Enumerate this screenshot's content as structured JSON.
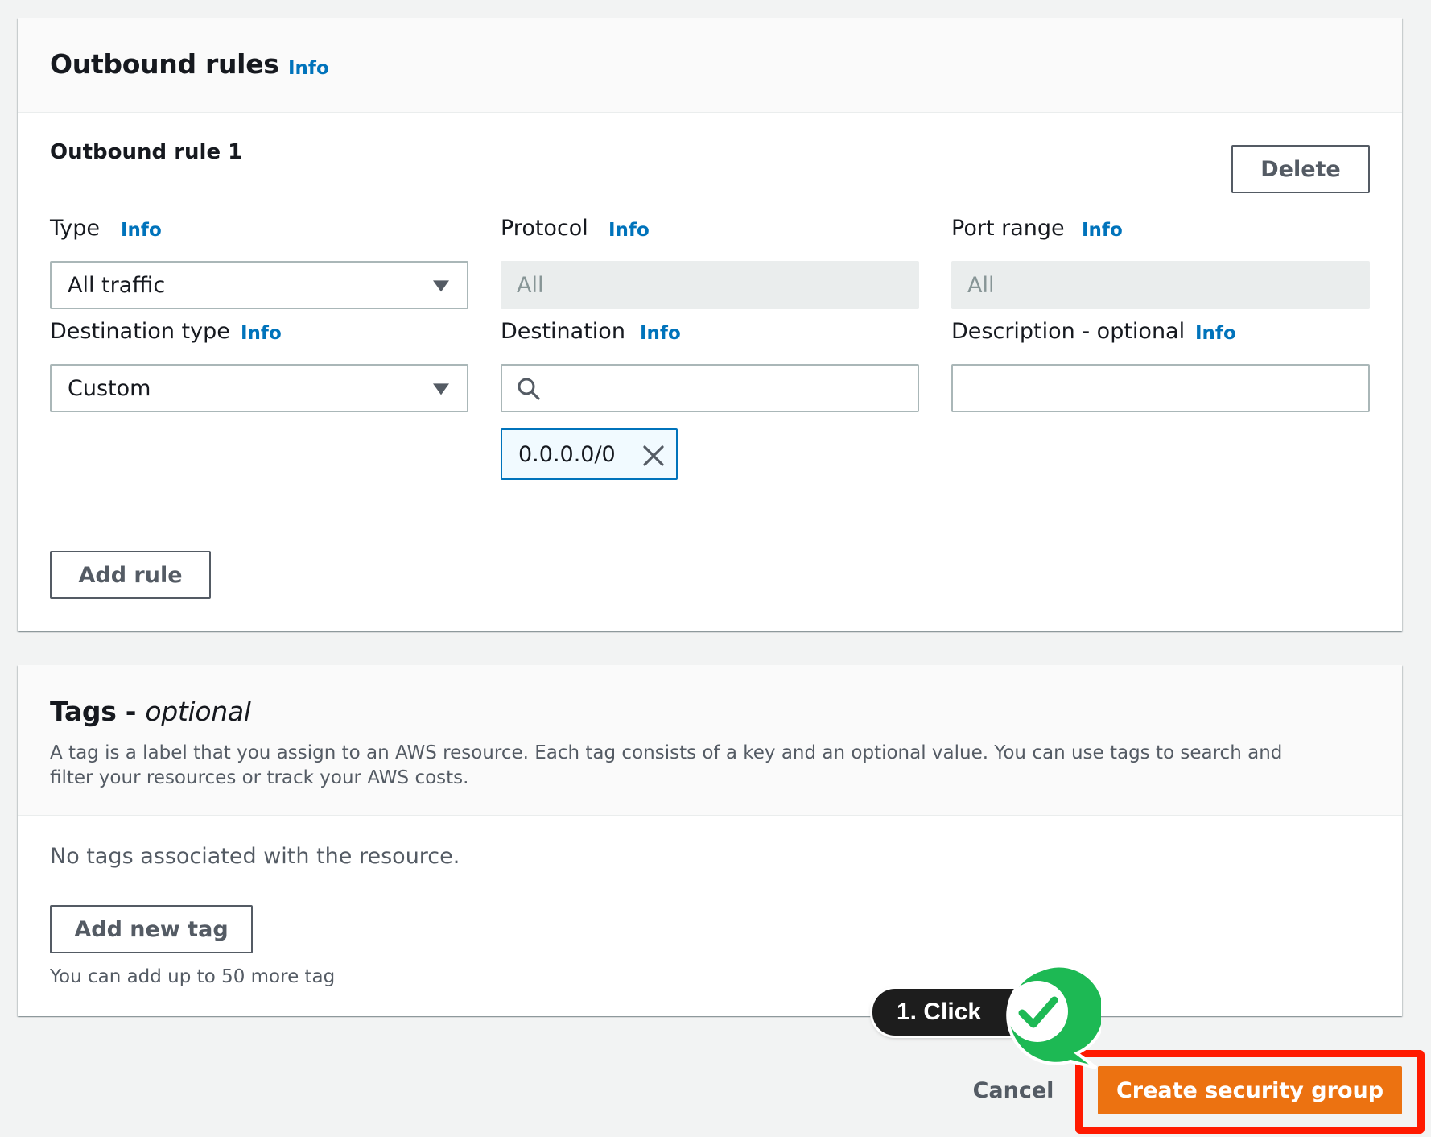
{
  "outbound": {
    "title": "Outbound rules",
    "info": "Info",
    "rule_title": "Outbound rule 1",
    "delete_label": "Delete",
    "fields": {
      "type": {
        "label": "Type",
        "info": "Info",
        "value": "All traffic"
      },
      "protocol": {
        "label": "Protocol",
        "info": "Info",
        "value": "All"
      },
      "port_range": {
        "label": "Port range",
        "info": "Info",
        "value": "All"
      },
      "destination_type": {
        "label": "Destination type",
        "info": "Info",
        "value": "Custom"
      },
      "destination": {
        "label": "Destination",
        "info": "Info",
        "value": "",
        "token": "0.0.0.0/0"
      },
      "description": {
        "label": "Description - optional",
        "info": "Info",
        "value": ""
      }
    },
    "add_rule_label": "Add rule"
  },
  "tags": {
    "title": "Tags - ",
    "title_optional": "optional",
    "description": "A tag is a label that you assign to an AWS resource. Each tag consists of a key and an optional value. You can use tags to search and filter your resources or track your AWS costs.",
    "empty_text": "No tags associated with the resource.",
    "add_tag_label": "Add new tag",
    "limit_text": "You can add up to 50 more tag"
  },
  "footer": {
    "cancel_label": "Cancel",
    "create_label": "Create security group"
  },
  "annotation": {
    "step_label": "1. Click"
  },
  "colors": {
    "primary": "#ec7211",
    "link": "#0073bb",
    "highlight": "#ff1a00",
    "check_green": "#1db954"
  }
}
